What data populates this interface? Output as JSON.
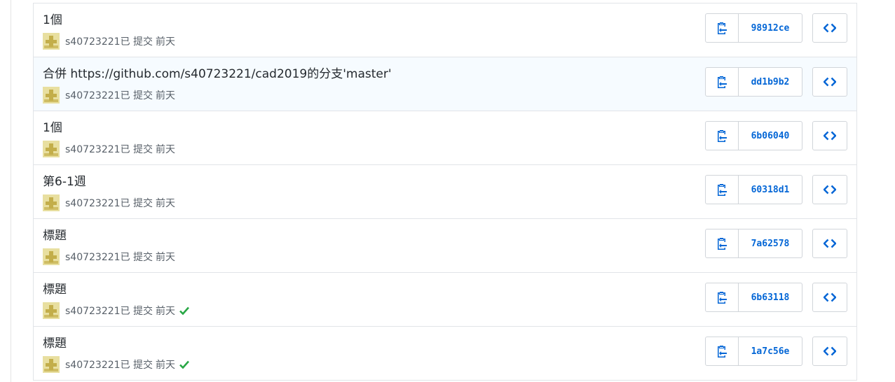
{
  "colors": {
    "link": "#0366d6",
    "check": "#28a745",
    "border": "#e1e4e8",
    "highlight_row": "#f6fbff"
  },
  "commits": [
    {
      "title": "1個",
      "author": "s40723221",
      "action": "已 提交",
      "time": "前天",
      "sha": "98912ce",
      "status": "none"
    },
    {
      "title": "合併 https://github.com/s40723221/cad2019的分支'master'",
      "author": "s40723221",
      "action": "已 提交",
      "time": "前天",
      "sha": "dd1b9b2",
      "status": "none"
    },
    {
      "title": "1個",
      "author": "s40723221",
      "action": "已 提交",
      "time": "前天",
      "sha": "6b06040",
      "status": "none"
    },
    {
      "title": "第6-1週",
      "author": "s40723221",
      "action": "已 提交",
      "time": "前天",
      "sha": "60318d1",
      "status": "none"
    },
    {
      "title": "標題",
      "author": "s40723221",
      "action": "已 提交",
      "time": "前天",
      "sha": "7a62578",
      "status": "none"
    },
    {
      "title": "標題",
      "author": "s40723221",
      "action": "已 提交",
      "time": "前天",
      "sha": "6b63118",
      "status": "success"
    },
    {
      "title": "標題",
      "author": "s40723221",
      "action": "已 提交",
      "time": "前天",
      "sha": "1a7c56e",
      "status": "success"
    }
  ],
  "icons": {
    "copy": "clipboard-icon",
    "browse": "code-icon",
    "status": "check-icon",
    "avatar": "identicon-avatar"
  }
}
